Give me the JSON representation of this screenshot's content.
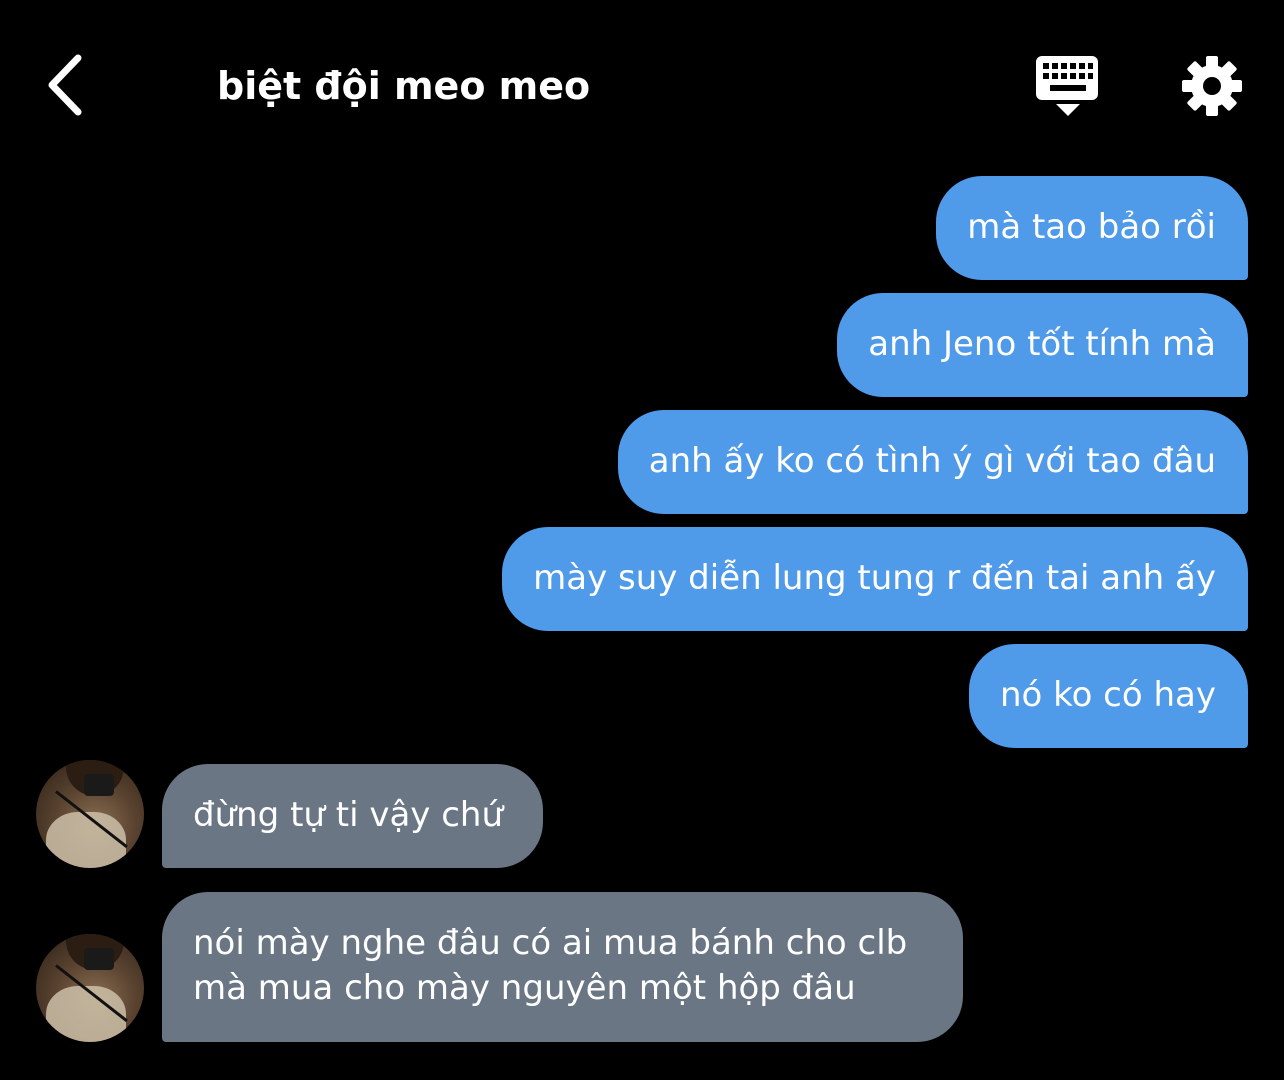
{
  "header": {
    "title": "biệt đội meo meo"
  },
  "icons": {
    "back": "chevron-left-icon",
    "keyboard": "keyboard-icon",
    "settings": "gear-icon"
  },
  "colors": {
    "background": "#000000",
    "outgoing_bubble": "#4f9ae9",
    "incoming_bubble": "#6a7683",
    "text": "#ffffff"
  },
  "messages": [
    {
      "direction": "outgoing",
      "text": "mà tao bảo rồi"
    },
    {
      "direction": "outgoing",
      "text": "anh Jeno tốt tính mà"
    },
    {
      "direction": "outgoing",
      "text": "anh ấy ko có tình ý gì với tao đâu"
    },
    {
      "direction": "outgoing",
      "text": "mày suy diễn lung tung r đến tai anh ấy"
    },
    {
      "direction": "outgoing",
      "text": "nó ko có hay"
    },
    {
      "direction": "incoming",
      "text": "đừng tự ti vậy chứ"
    },
    {
      "direction": "incoming",
      "lines": [
        "nói mày nghe đâu có ai mua bánh cho clb",
        "mà mua cho mày nguyên một hộp đâu"
      ]
    }
  ]
}
